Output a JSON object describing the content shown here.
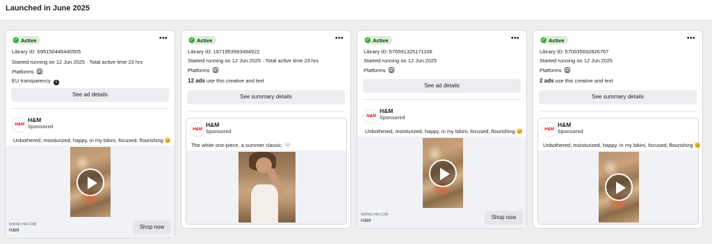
{
  "page": {
    "section_title": "Launched in June 2025"
  },
  "common": {
    "status": "Active",
    "menu": "•••",
    "platforms_label": "Platforms",
    "brand": "H&M",
    "sponsored": "Sponsored",
    "logo_text": "H&M",
    "shop_now": "Shop now",
    "footer_url": "WWW2.HM.COM",
    "footer_name": "H&M"
  },
  "cards": [
    {
      "library_id": "Library ID: 695150446440505",
      "started": "Started running on 12 Jun 2025 · Total active time 23 hrs",
      "eu_transparency": "EU transparency",
      "button": "See ad details",
      "caption": "Unbothered, moisturized, happy, in my bikini, focused, flourishing 😉",
      "media": "video"
    },
    {
      "library_id": "Library ID: 1671953993494922",
      "started": "Started running on 12 Jun 2025 · Total active time 23 hrs",
      "ads_count": "12 ads",
      "ads_text": " use this creative and text",
      "button": "See summary details",
      "caption": "The white one-piece, a summer classic. 🤍",
      "media": "photo"
    },
    {
      "library_id": "Library ID: 576591325171106",
      "started": "Started running on 12 Jun 2025",
      "button": "See ad details",
      "caption": "Unbothered, moisturized, happy, in my bikini, focused, flourishing 😉",
      "media": "video"
    },
    {
      "library_id": "Library ID: 570035692826767",
      "started": "Started running on 12 Jun 2025",
      "ads_count": "2 ads",
      "ads_text": " use this creative and text",
      "button": "See summary details",
      "caption": "Unbothered, moisturized, happy, in my bikini, focused, flourishing 😉",
      "media": "video"
    }
  ]
}
